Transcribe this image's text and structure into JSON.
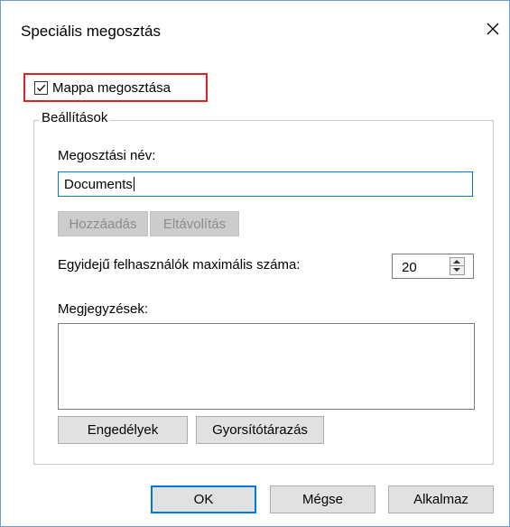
{
  "dialog": {
    "title": "Speciális megosztás",
    "close_icon": "close-icon"
  },
  "share_folder": {
    "label": "Mappa megosztása",
    "checked": true
  },
  "settings": {
    "legend": "Beállítások",
    "share_name_label": "Megosztási név:",
    "share_name_value": "Documents",
    "add_label": "Hozzáadás",
    "remove_label": "Eltávolítás",
    "max_users_label": "Egyidejű felhasználók maximális száma:",
    "max_users_value": "20",
    "comments_label": "Megjegyzések:",
    "comments_value": "",
    "permissions_label": "Engedélyek",
    "caching_label": "Gyorsítótárazás"
  },
  "footer": {
    "ok_label": "OK",
    "cancel_label": "Mégse",
    "apply_label": "Alkalmaz"
  }
}
